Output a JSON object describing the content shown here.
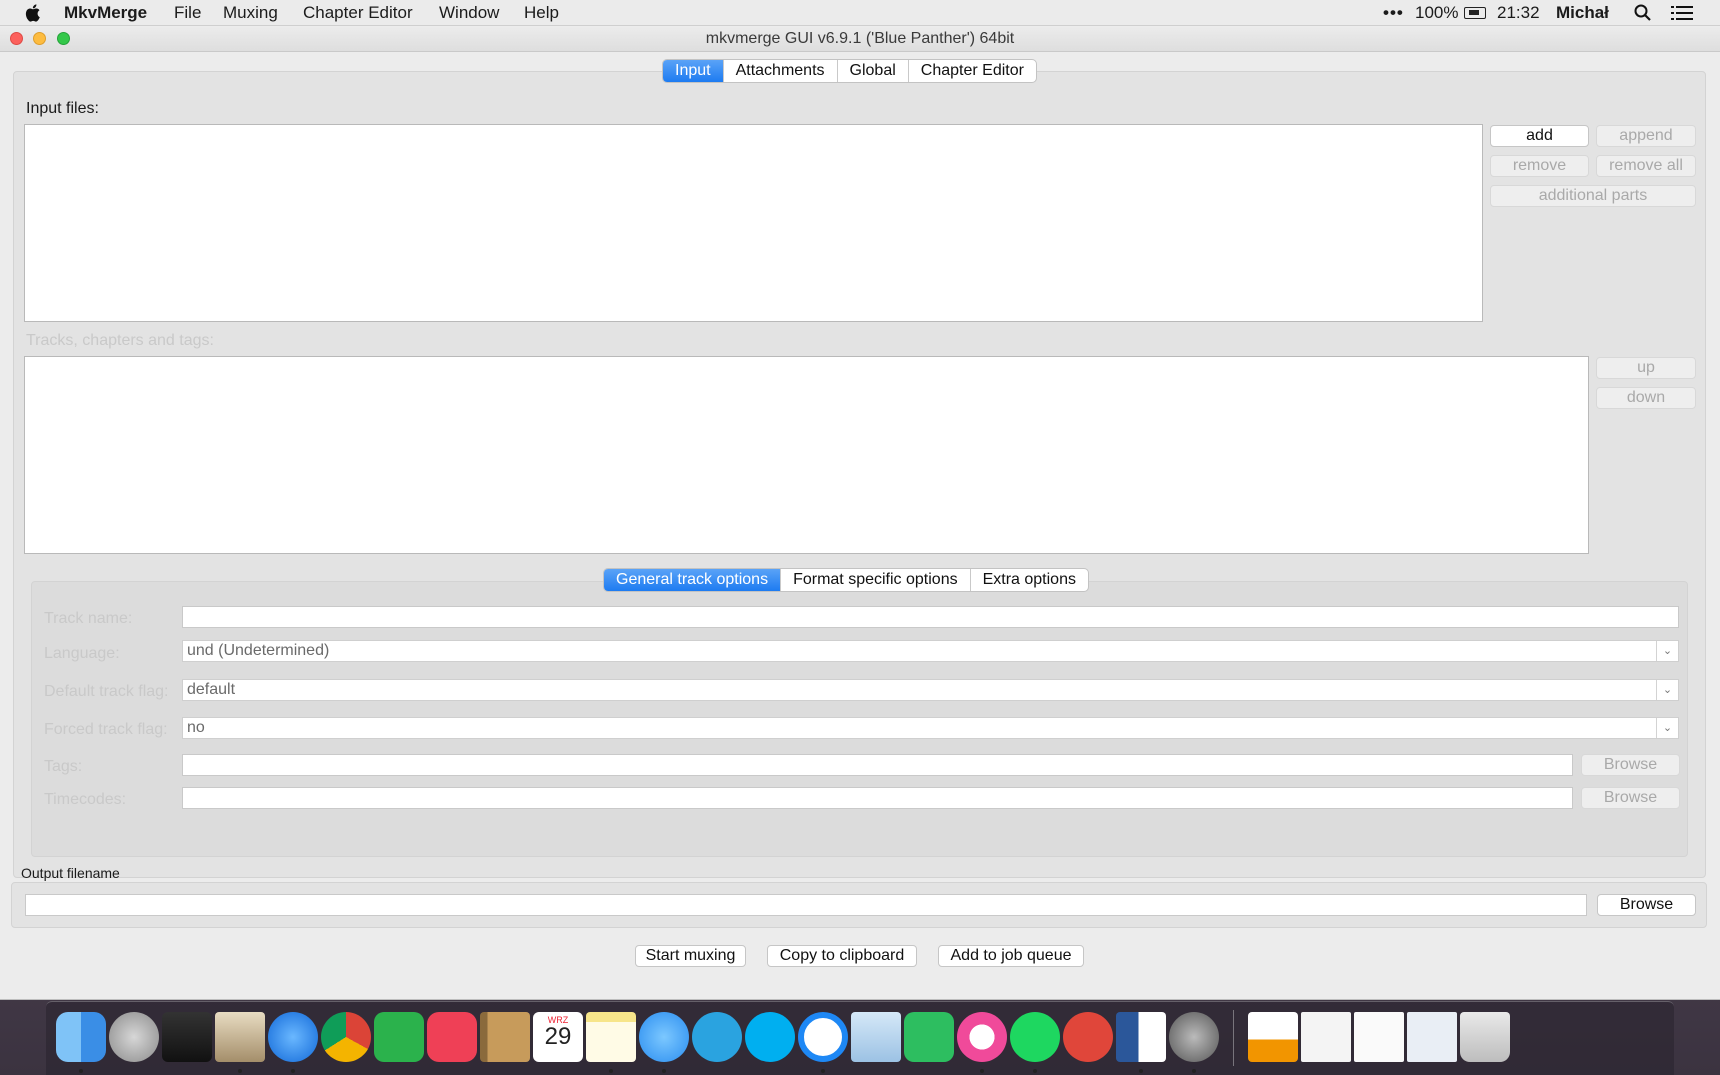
{
  "menubar": {
    "app": "MkvMerge",
    "items": [
      "File",
      "Muxing",
      "Chapter Editor",
      "Window",
      "Help"
    ],
    "battery": "100%",
    "clock": "21:32",
    "user": "Michał"
  },
  "window": {
    "title": "mkvmerge GUI v6.9.1 ('Blue Panther') 64bit",
    "tabs": [
      "Input",
      "Attachments",
      "Global",
      "Chapter Editor"
    ],
    "selected_tab": "Input"
  },
  "input": {
    "files_label": "Input files:",
    "buttons": {
      "add": "add",
      "append": "append",
      "remove": "remove",
      "remove_all": "remove all",
      "additional_parts": "additional parts"
    },
    "tracks_label": "Tracks, chapters and tags:",
    "up": "up",
    "down": "down"
  },
  "track_options": {
    "tabs": [
      "General track options",
      "Format specific options",
      "Extra options"
    ],
    "selected_tab": "General track options",
    "labels": [
      "Track name:",
      "Language:",
      "Default track flag:",
      "Forced track flag:",
      "Tags:",
      "Timecodes:"
    ],
    "language_value": "und (Undetermined)",
    "default_flag_value": "default",
    "forced_flag_value": "no",
    "browse": "Browse"
  },
  "output": {
    "label": "Output filename",
    "browse": "Browse"
  },
  "actions": {
    "start": "Start muxing",
    "copy": "Copy to clipboard",
    "queue": "Add to job queue"
  },
  "dock": {
    "calendar_month": "WRZ",
    "calendar_day": "29",
    "icons": [
      "finder-icon",
      "launchpad-icon",
      "photo-booth-icon",
      "mail-icon",
      "safari-icon",
      "chrome-icon",
      "feedly-icon",
      "pocket-icon",
      "contacts-icon",
      "calendar-icon",
      "notes-icon",
      "messages-icon",
      "telegram-icon",
      "skype-icon",
      "messenger-icon",
      "preview-icon",
      "evernote-icon",
      "itunes-icon",
      "spotify-icon",
      "transmit-icon",
      "word-icon",
      "vlc-icon",
      "mkv-icon",
      "trash-icon"
    ]
  },
  "colors": {
    "accent": "#1d7bf1",
    "window_bg": "#ececec",
    "panel_bg": "#e3e3e3"
  }
}
